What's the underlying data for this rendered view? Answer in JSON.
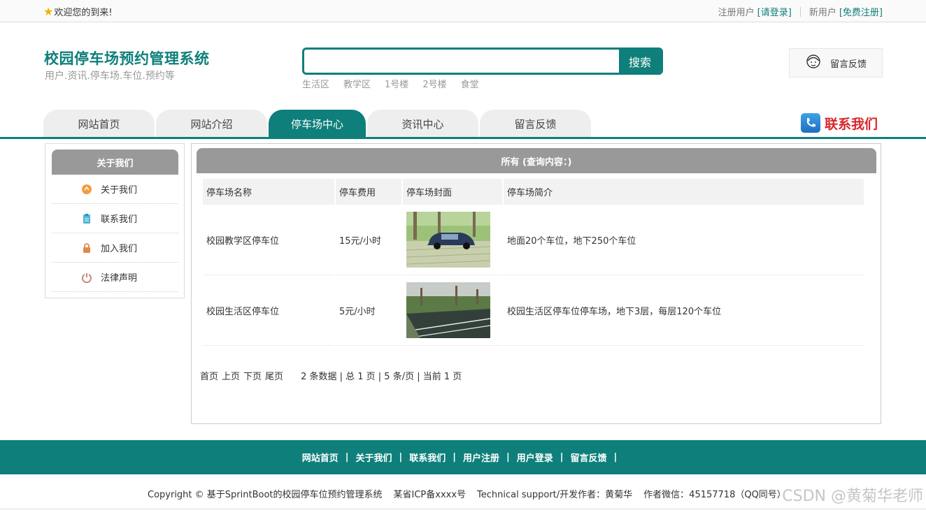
{
  "topbar": {
    "welcome": "欢迎您的到来!",
    "registered_label": "注册用户",
    "login_link": "[请登录]",
    "new_user_label": "新用户",
    "register_link": "[免费注册]"
  },
  "header": {
    "title": "校园停车场预约管理系统",
    "subtitle": "用户.资讯.停车场.车位.预约等",
    "search_placeholder": "",
    "search_button": "搜索",
    "hotwords": [
      "生活区",
      "教学区",
      "1号楼",
      "2号楼",
      "食堂"
    ],
    "feedback_button": "留言反馈"
  },
  "nav": {
    "tabs": [
      "网站首页",
      "网站介绍",
      "停车场中心",
      "资讯中心",
      "留言反馈"
    ],
    "active_tab": "停车场中心",
    "contact_banner": "联系我们"
  },
  "sidebar": {
    "title": "关于我们",
    "items": [
      {
        "label": "关于我们",
        "icon": "about-icon"
      },
      {
        "label": "联系我们",
        "icon": "clipboard-icon"
      },
      {
        "label": "加入我们",
        "icon": "lock-icon"
      },
      {
        "label": "法律声明",
        "icon": "power-icon"
      }
    ]
  },
  "main": {
    "title": "所有 (查询内容：)",
    "columns": [
      "停车场名称",
      "停车费用",
      "停车场封面",
      "停车场简介"
    ],
    "rows": [
      {
        "name": "校园教学区停车位",
        "fee": "15元/小时",
        "cover": "car-parking-photo",
        "intro": "地面20个车位，地下250个车位"
      },
      {
        "name": "校园生活区停车位",
        "fee": "5元/小时",
        "cover": "parking-lot-photo",
        "intro": "校园生活区停车位停车场，地下3层，每层120个车位"
      }
    ],
    "pager": {
      "first": "首页",
      "prev": "上页",
      "next": "下页",
      "last": "尾页",
      "stats": "2 条数据 | 总 1 页 | 5 条/页 | 当前 1 页"
    }
  },
  "footer": {
    "links": [
      "网站首页",
      "关于我们",
      "联系我们",
      "用户注册",
      "用户登录",
      "留言反馈"
    ],
    "copyright": "Copyright © 基于SprintBoot的校园停车位预约管理系统",
    "icp": "某省ICP备xxxx号",
    "support": "Technical support/开发作者：黄菊华",
    "wechat": "作者微信：45157718（QQ同号）",
    "watermark": "CSDN @黄菊华老师"
  },
  "colors": {
    "primary": "#0e7f7a",
    "header_gray": "#999999",
    "contact_red": "#d9262a"
  }
}
